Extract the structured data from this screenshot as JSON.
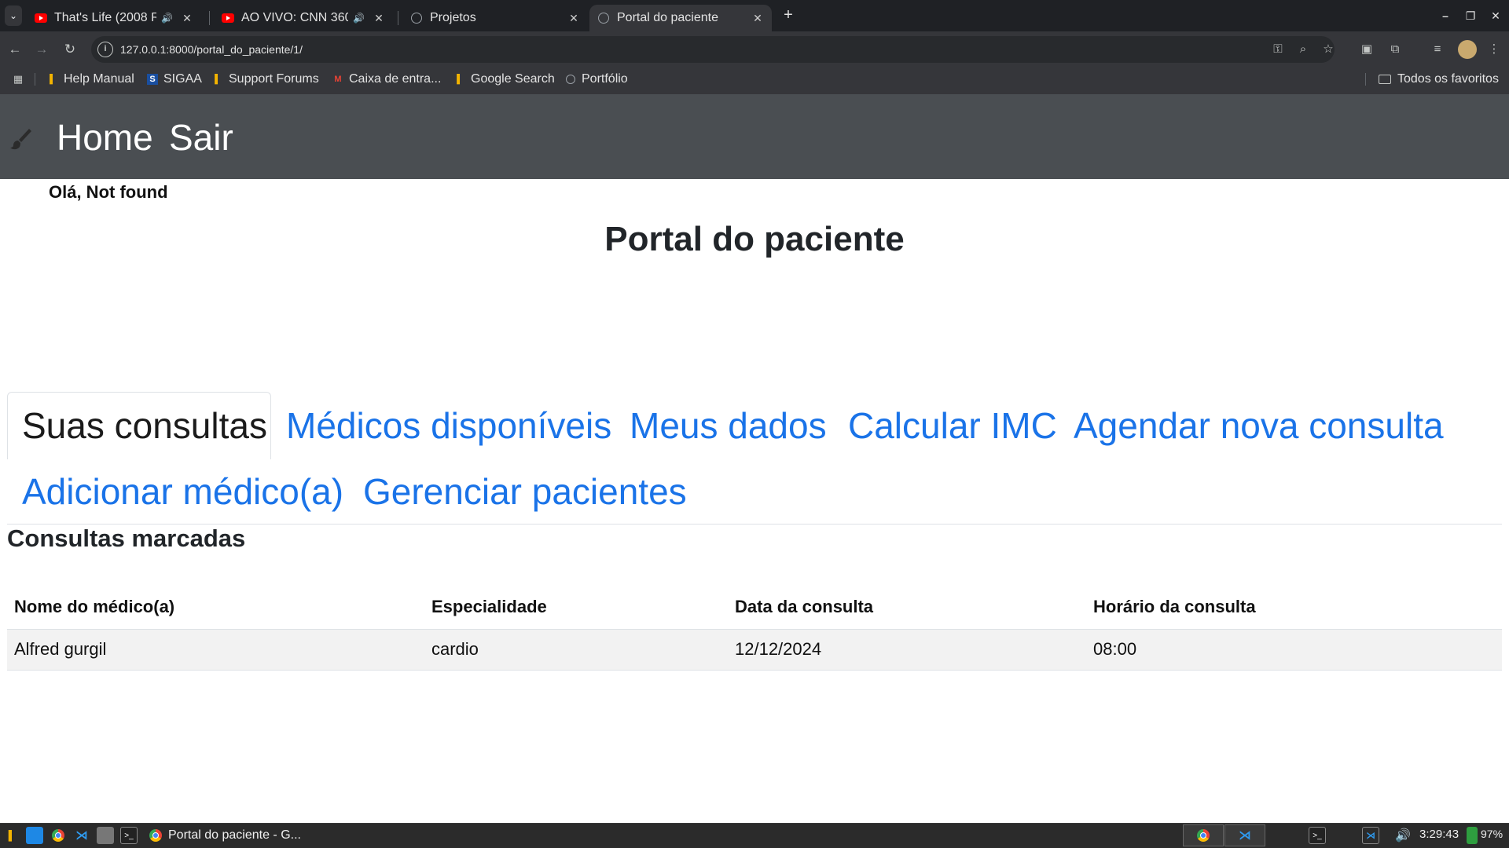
{
  "browser": {
    "tabs": [
      {
        "title": "That's Life (2008 Re",
        "icon": "youtube-icon",
        "audio": true
      },
      {
        "title": "AO VIVO: CNN 360º",
        "icon": "youtube-icon",
        "audio": true
      },
      {
        "title": "Projetos",
        "icon": "globe-icon",
        "audio": false
      },
      {
        "title": "Portal do paciente",
        "icon": "globe-icon",
        "audio": false,
        "active": true
      }
    ],
    "url": "127.0.0.1:8000/portal_do_paciente/1/",
    "bookmarks": [
      {
        "label": "Help Manual",
        "icon": "bookmark-icon"
      },
      {
        "label": "SIGAA",
        "icon": "sigaa-icon"
      },
      {
        "label": "Support Forums",
        "icon": "bookmark-icon"
      },
      {
        "label": "Caixa de entra...",
        "icon": "gmail-icon"
      },
      {
        "label": "Google Search",
        "icon": "bookmark-icon"
      },
      {
        "label": "Portfólio",
        "icon": "globe-icon"
      }
    ],
    "all_bookmarks": "Todos os favoritos"
  },
  "nav": {
    "home": "Home",
    "logout": "Sair"
  },
  "greeting": "Olá, Not found",
  "page_title": "Portal do paciente",
  "tabs": [
    {
      "label": "Suas consultas",
      "active": true
    },
    {
      "label": "Médicos disponíveis"
    },
    {
      "label": "Meus dados"
    },
    {
      "label": "Calcular IMC"
    },
    {
      "label": "Agendar nova consulta"
    },
    {
      "label": "Adicionar médico(a)"
    },
    {
      "label": "Gerenciar pacientes"
    }
  ],
  "section_title": "Consultas marcadas",
  "table": {
    "headers": [
      "Nome do médico(a)",
      "Especialidade",
      "Data da consulta",
      "Horário da consulta"
    ],
    "rows": [
      [
        "Alfred gurgil",
        "cardio",
        "12/12/2024",
        "08:00"
      ]
    ]
  },
  "taskbar": {
    "active_window": "Portal do paciente - G...",
    "clock": "3:29:43",
    "battery": "97%"
  },
  "colors": {
    "link": "#1a73e8",
    "navbar": "#4a4e52"
  }
}
